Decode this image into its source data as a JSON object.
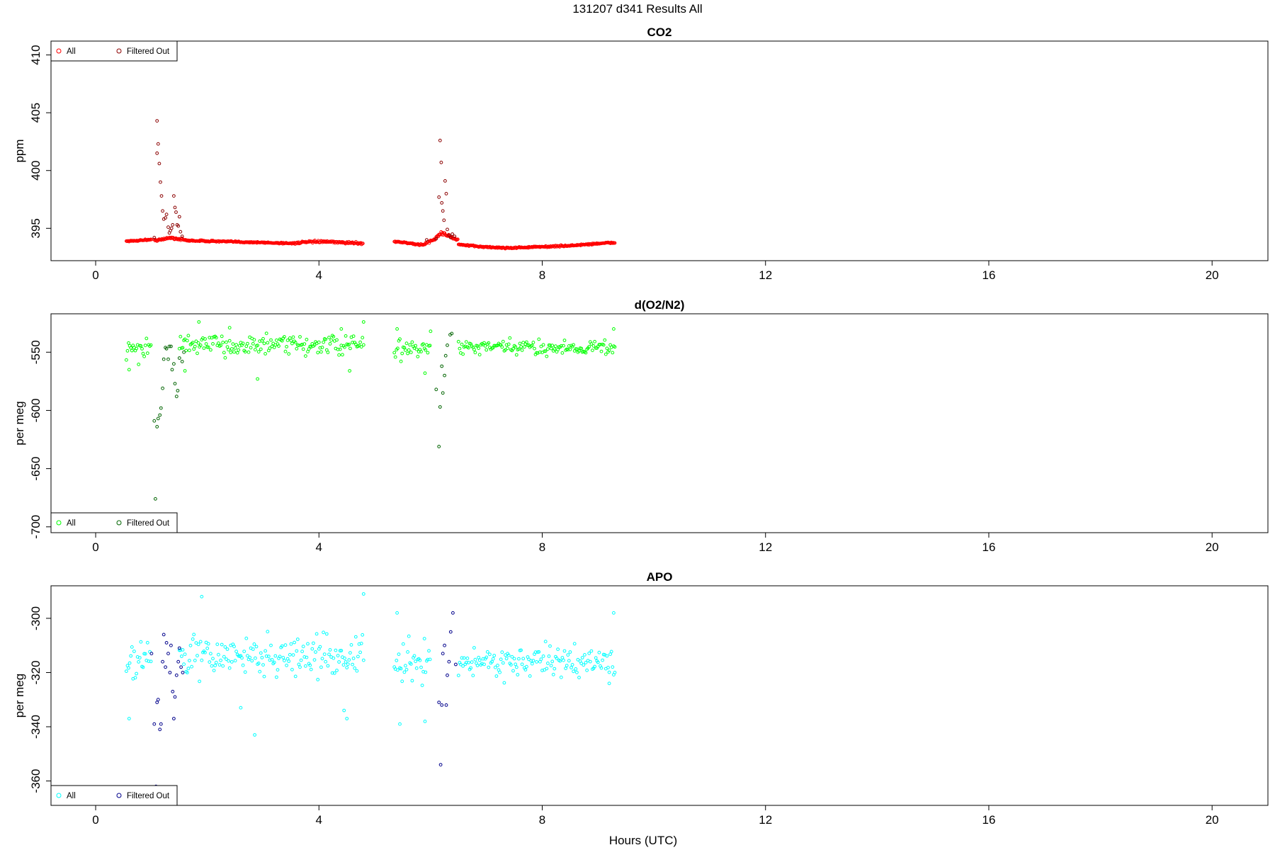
{
  "main_title": "131207   d341   Results All",
  "xlabel": "Hours (UTC)",
  "x_axis": {
    "ticks": [
      0,
      4,
      8,
      12,
      16,
      20
    ],
    "xlim": [
      -0.8,
      21.0
    ]
  },
  "legend": {
    "all_label": "All",
    "filtered_label": "Filtered Out"
  },
  "chart_data": [
    {
      "type": "scatter",
      "title": "CO2",
      "ylabel": "ppm",
      "ylim": [
        392.2,
        411.2
      ],
      "yticks": [
        395,
        400,
        405,
        410
      ],
      "legend_position": "top-left",
      "colors": {
        "all": "#ff0000",
        "filtered": "#8b0000"
      },
      "series": [
        {
          "name": "All",
          "style": "baseline",
          "segments": [
            {
              "x_start": 0.55,
              "x_end": 1.0,
              "base": [
                393.9,
                393.9,
                393.95,
                394.0,
                394.0
              ],
              "noise": 0.05
            },
            {
              "x_start": 1.05,
              "x_end": 1.6,
              "base": [
                394.0,
                394.0,
                394.2,
                394.1,
                394.0
              ],
              "noise": 0.1
            },
            {
              "x_start": 1.6,
              "x_end": 3.5,
              "base": [
                393.95,
                393.9,
                393.85,
                393.8,
                393.75,
                393.7
              ],
              "noise": 0.06
            },
            {
              "x_start": 3.5,
              "x_end": 4.8,
              "base": [
                393.7,
                393.8,
                393.85,
                393.8,
                393.75,
                393.7
              ],
              "noise": 0.08
            },
            {
              "x_start": 5.35,
              "x_end": 5.9,
              "base": [
                393.85,
                393.8,
                393.7,
                393.6,
                393.55
              ],
              "noise": 0.06
            },
            {
              "x_start": 5.9,
              "x_end": 6.5,
              "base": [
                393.7,
                394.0,
                394.6,
                394.3,
                393.9
              ],
              "noise": 0.12
            },
            {
              "x_start": 6.5,
              "x_end": 8.0,
              "base": [
                393.6,
                393.45,
                393.35,
                393.3,
                393.35,
                393.4
              ],
              "noise": 0.06
            },
            {
              "x_start": 8.0,
              "x_end": 9.3,
              "base": [
                393.4,
                393.45,
                393.5,
                393.6,
                393.7,
                393.75
              ],
              "noise": 0.06
            }
          ]
        },
        {
          "name": "Filtered Out",
          "style": "points",
          "points": [
            [
              1.05,
              394.2
            ],
            [
              1.08,
              409.8
            ],
            [
              1.1,
              404.3
            ],
            [
              1.1,
              401.5
            ],
            [
              1.12,
              402.3
            ],
            [
              1.14,
              400.6
            ],
            [
              1.16,
              399.0
            ],
            [
              1.18,
              397.8
            ],
            [
              1.2,
              396.5
            ],
            [
              1.22,
              395.8
            ],
            [
              1.25,
              395.9
            ],
            [
              1.27,
              396.2
            ],
            [
              1.3,
              395.1
            ],
            [
              1.32,
              394.6
            ],
            [
              1.34,
              394.8
            ],
            [
              1.36,
              395.0
            ],
            [
              1.38,
              395.3
            ],
            [
              1.4,
              397.8
            ],
            [
              1.42,
              396.8
            ],
            [
              1.44,
              396.4
            ],
            [
              1.46,
              395.3
            ],
            [
              1.48,
              395.2
            ],
            [
              1.5,
              396.0
            ],
            [
              1.52,
              394.7
            ],
            [
              1.55,
              394.3
            ],
            [
              5.93,
              394.0
            ],
            [
              6.1,
              394.1
            ],
            [
              6.15,
              397.7
            ],
            [
              6.17,
              402.6
            ],
            [
              6.19,
              400.7
            ],
            [
              6.2,
              397.2
            ],
            [
              6.22,
              396.5
            ],
            [
              6.24,
              395.7
            ],
            [
              6.26,
              399.1
            ],
            [
              6.28,
              398.0
            ],
            [
              6.3,
              394.9
            ],
            [
              6.33,
              394.4
            ],
            [
              6.36,
              394.2
            ],
            [
              6.39,
              394.5
            ],
            [
              6.43,
              394.3
            ]
          ]
        }
      ]
    },
    {
      "type": "scatter",
      "title": "d(O2/N2)",
      "ylabel": "per meg",
      "ylim": [
        -705,
        -517
      ],
      "yticks": [
        -550,
        -600,
        -650,
        -700
      ],
      "legend_position": "bottom-left",
      "colors": {
        "all": "#00ff00",
        "filtered": "#006400"
      },
      "series": [
        {
          "name": "All",
          "style": "cloud",
          "segments": [
            {
              "x_start": 0.55,
              "x_end": 1.0,
              "center": -547,
              "spread": 9
            },
            {
              "x_start": 1.5,
              "x_end": 4.8,
              "center": -544,
              "spread": 8
            },
            {
              "x_start": 5.35,
              "x_end": 6.0,
              "center": -547,
              "spread": 9
            },
            {
              "x_start": 6.5,
              "x_end": 9.3,
              "center": -546,
              "spread": 6
            }
          ],
          "points": [
            [
              1.85,
              -524
            ],
            [
              2.9,
              -573
            ],
            [
              4.8,
              -524
            ],
            [
              4.55,
              -566
            ],
            [
              5.4,
              -530
            ],
            [
              5.9,
              -568
            ],
            [
              0.6,
              -565
            ],
            [
              1.6,
              -566
            ],
            [
              6.0,
              -532
            ],
            [
              9.28,
              -530
            ],
            [
              2.4,
              -529
            ],
            [
              4.4,
              -530
            ]
          ]
        },
        {
          "name": "Filtered Out",
          "style": "points",
          "points": [
            [
              1.05,
              -609
            ],
            [
              1.07,
              -676
            ],
            [
              1.1,
              -614
            ],
            [
              1.12,
              -607
            ],
            [
              1.15,
              -604
            ],
            [
              1.17,
              -598
            ],
            [
              1.2,
              -581
            ],
            [
              1.22,
              -556
            ],
            [
              1.25,
              -546
            ],
            [
              1.27,
              -547
            ],
            [
              1.3,
              -556
            ],
            [
              1.32,
              -545
            ],
            [
              1.35,
              -545
            ],
            [
              1.37,
              -565
            ],
            [
              1.4,
              -560
            ],
            [
              1.42,
              -577
            ],
            [
              1.45,
              -588
            ],
            [
              1.47,
              -583
            ],
            [
              1.5,
              -555
            ],
            [
              1.55,
              -558
            ],
            [
              1.58,
              -550
            ],
            [
              6.1,
              -582
            ],
            [
              6.15,
              -631
            ],
            [
              6.17,
              -597
            ],
            [
              6.2,
              -562
            ],
            [
              6.22,
              -585
            ],
            [
              6.25,
              -570
            ],
            [
              6.27,
              -553
            ],
            [
              6.3,
              -544
            ],
            [
              6.35,
              -535
            ],
            [
              6.38,
              -534
            ]
          ]
        }
      ]
    },
    {
      "type": "scatter",
      "title": "APO",
      "ylabel": "per meg",
      "ylim": [
        -369,
        -288
      ],
      "yticks": [
        -300,
        -320,
        -340,
        -360
      ],
      "legend_position": "bottom-left",
      "colors": {
        "all": "#00ffff",
        "filtered": "#00008b"
      },
      "series": [
        {
          "name": "All",
          "style": "cloud",
          "segments": [
            {
              "x_start": 0.55,
              "x_end": 1.0,
              "center": -315,
              "spread": 7
            },
            {
              "x_start": 1.5,
              "x_end": 4.8,
              "center": -314,
              "spread": 7
            },
            {
              "x_start": 5.35,
              "x_end": 6.0,
              "center": -317,
              "spread": 8
            },
            {
              "x_start": 6.5,
              "x_end": 9.3,
              "center": -316,
              "spread": 5
            }
          ],
          "points": [
            [
              1.9,
              -292
            ],
            [
              4.8,
              -291
            ],
            [
              2.85,
              -343
            ],
            [
              0.6,
              -337
            ],
            [
              5.45,
              -339
            ],
            [
              4.5,
              -337
            ],
            [
              5.9,
              -338
            ],
            [
              9.28,
              -298
            ],
            [
              5.4,
              -298
            ],
            [
              2.6,
              -333
            ],
            [
              4.45,
              -334
            ],
            [
              9.2,
              -324
            ]
          ]
        },
        {
          "name": "Filtered Out",
          "style": "points",
          "points": [
            [
              1.0,
              -313
            ],
            [
              1.05,
              -339
            ],
            [
              1.08,
              -362
            ],
            [
              1.1,
              -331
            ],
            [
              1.12,
              -330
            ],
            [
              1.15,
              -341
            ],
            [
              1.17,
              -339
            ],
            [
              1.2,
              -316
            ],
            [
              1.22,
              -306
            ],
            [
              1.25,
              -318
            ],
            [
              1.27,
              -309
            ],
            [
              1.3,
              -313
            ],
            [
              1.33,
              -320
            ],
            [
              1.35,
              -310
            ],
            [
              1.38,
              -327
            ],
            [
              1.4,
              -337
            ],
            [
              1.42,
              -329
            ],
            [
              1.45,
              -321
            ],
            [
              1.48,
              -316
            ],
            [
              1.5,
              -311
            ],
            [
              1.53,
              -318
            ],
            [
              1.56,
              -320
            ],
            [
              6.15,
              -331
            ],
            [
              6.18,
              -354
            ],
            [
              6.2,
              -332
            ],
            [
              6.22,
              -313
            ],
            [
              6.25,
              -310
            ],
            [
              6.28,
              -332
            ],
            [
              6.3,
              -321
            ],
            [
              6.33,
              -316
            ],
            [
              6.36,
              -305
            ],
            [
              6.4,
              -298
            ],
            [
              6.45,
              -317
            ]
          ]
        }
      ]
    }
  ]
}
